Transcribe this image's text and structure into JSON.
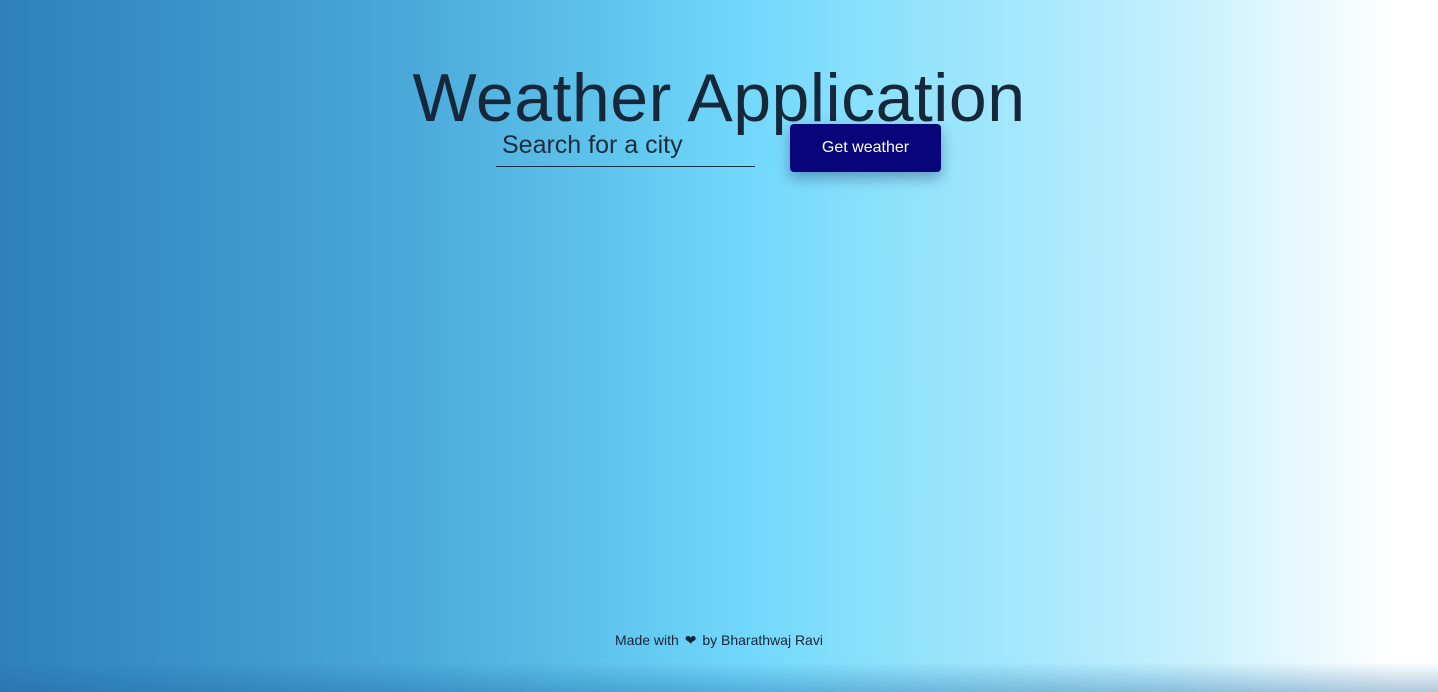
{
  "header": {
    "title": "Weather Application"
  },
  "search": {
    "placeholder": "Search for a city",
    "value": "",
    "button_label": "Get weather"
  },
  "footer": {
    "prefix": "Made with",
    "heart": "❤",
    "suffix": "by Bharathwaj Ravi"
  },
  "icons": {
    "heart": "heart-icon"
  },
  "colors": {
    "button_bg": "#080479",
    "button_text": "#ffffff",
    "title_text": "#16273a",
    "gradient_left": "#2f80bb",
    "gradient_mid": "#72d8fb",
    "gradient_right": "#ffffff"
  }
}
